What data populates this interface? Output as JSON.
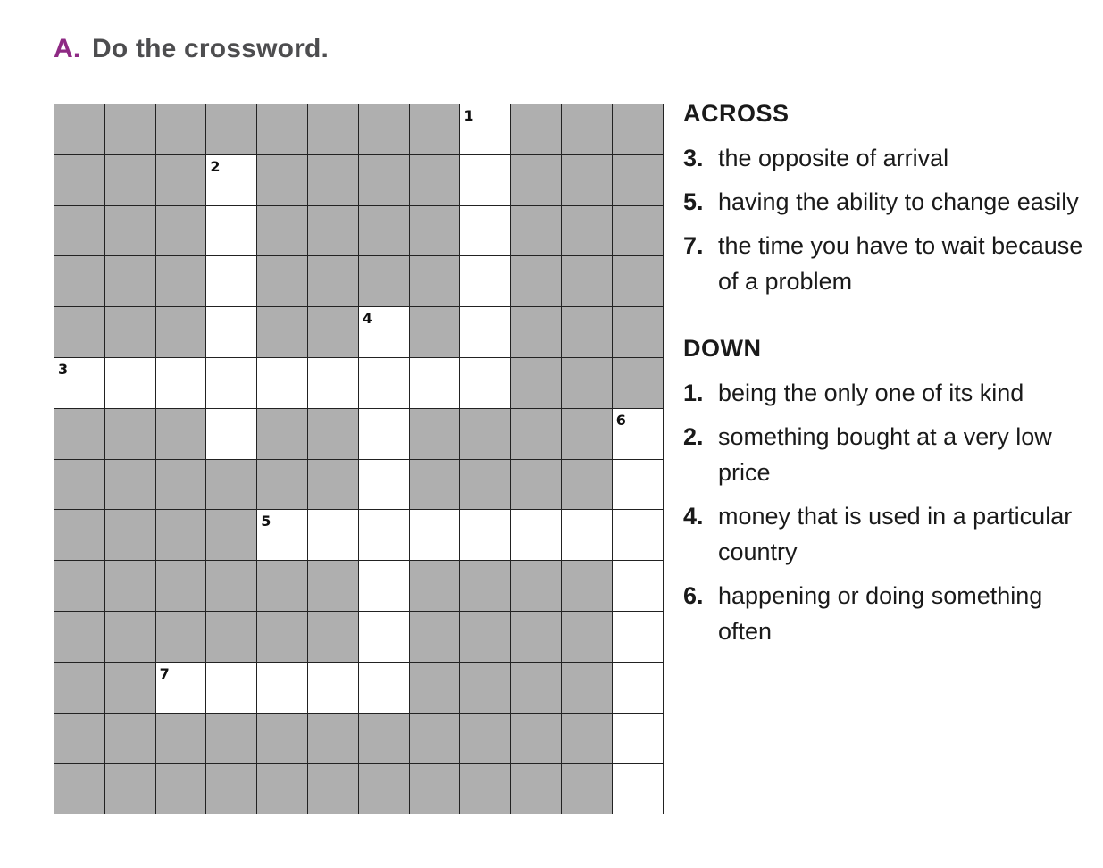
{
  "instruction": {
    "letter": "A.",
    "text": "Do the crossword."
  },
  "grid": {
    "rows": 14,
    "cols": 12,
    "open_cells": [
      [
        0,
        9
      ],
      [
        1,
        9
      ],
      [
        2,
        9
      ],
      [
        3,
        9
      ],
      [
        4,
        9
      ],
      [
        5,
        9
      ],
      [
        1,
        4
      ],
      [
        2,
        4
      ],
      [
        3,
        4
      ],
      [
        4,
        4
      ],
      [
        5,
        4
      ],
      [
        6,
        4
      ],
      [
        7,
        4
      ],
      [
        5,
        1
      ],
      [
        5,
        2
      ],
      [
        5,
        3
      ],
      [
        5,
        4
      ],
      [
        5,
        5
      ],
      [
        5,
        6
      ],
      [
        5,
        7
      ],
      [
        5,
        8
      ],
      [
        5,
        9
      ],
      [
        4,
        7
      ],
      [
        5,
        7
      ],
      [
        6,
        7
      ],
      [
        7,
        7
      ],
      [
        8,
        7
      ],
      [
        9,
        7
      ],
      [
        10,
        7
      ],
      [
        11,
        7
      ],
      [
        8,
        5
      ],
      [
        8,
        6
      ],
      [
        8,
        7
      ],
      [
        8,
        8
      ],
      [
        8,
        9
      ],
      [
        8,
        10
      ],
      [
        8,
        11
      ],
      [
        8,
        12
      ],
      [
        7,
        12
      ],
      [
        8,
        12
      ],
      [
        9,
        12
      ],
      [
        10,
        12
      ],
      [
        11,
        12
      ],
      [
        12,
        12
      ],
      [
        13,
        12
      ],
      [
        14,
        12
      ],
      [
        12,
        3
      ],
      [
        12,
        4
      ],
      [
        12,
        5
      ],
      [
        12,
        6
      ],
      [
        12,
        7
      ]
    ],
    "numbers": [
      {
        "row": 1,
        "col": 9,
        "label": "1"
      },
      {
        "row": 2,
        "col": 4,
        "label": "2"
      },
      {
        "row": 5,
        "col": 7,
        "label": "4"
      },
      {
        "row": 6,
        "col": 1,
        "label": "3"
      },
      {
        "row": 7,
        "col": 12,
        "label": "6"
      },
      {
        "row": 9,
        "col": 5,
        "label": "5"
      },
      {
        "row": 12,
        "col": 3,
        "label": "7"
      }
    ]
  },
  "across": {
    "heading": "ACROSS",
    "clues": [
      {
        "num": "3.",
        "text": "the opposite of arrival"
      },
      {
        "num": "5.",
        "text": "having the ability to change easily"
      },
      {
        "num": "7.",
        "text": "the time you have to wait because of a problem"
      }
    ]
  },
  "down": {
    "heading": "DOWN",
    "clues": [
      {
        "num": "1.",
        "text": "being the only one of its kind"
      },
      {
        "num": "2.",
        "text": "something bought at a very low price"
      },
      {
        "num": "4.",
        "text": "money that is used in a particular country"
      },
      {
        "num": "6.",
        "text": "happening or doing something often"
      }
    ]
  }
}
